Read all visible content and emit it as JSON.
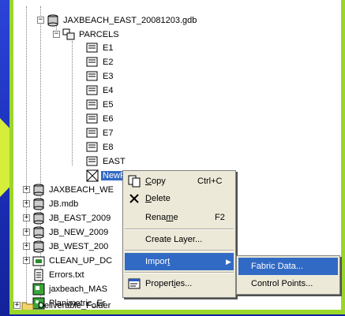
{
  "tree": {
    "gdb_east": "JAXBEACH_EAST_20081203.gdb",
    "parcels": "PARCELS",
    "children": [
      "E1",
      "E2",
      "E3",
      "E4",
      "E5",
      "E6",
      "E7",
      "E8",
      "EAST"
    ],
    "new_fabric": "NewFabric",
    "siblings": [
      "JAXBEACH_WE",
      "JB.mdb",
      "JB_EAST_2009",
      "JB_NEW_2009",
      "JB_WEST_200",
      "CLEAN_UP_DC",
      "Errors.txt",
      "jaxbeach_MAS",
      "Planimetric_Er"
    ],
    "deliverable": "Deliverable_Folder"
  },
  "context_menu": {
    "copy": {
      "pre": "",
      "ul": "C",
      "post": "opy",
      "shortcut": "Ctrl+C"
    },
    "delete": {
      "pre": "",
      "ul": "D",
      "post": "elete"
    },
    "rename": {
      "pre": "Rena",
      "ul": "m",
      "post": "e",
      "shortcut": "F2"
    },
    "create_layer": "Create Layer...",
    "import": {
      "pre": "Impor",
      "ul": "t",
      "post": ""
    },
    "properties": {
      "pre": "Propert",
      "ul": "i",
      "post": "es..."
    }
  },
  "submenu": {
    "fabric_data": "Fabric Data...",
    "control_points": "Control Points..."
  },
  "colors": {
    "background": "#1a2fb8",
    "frame": "#9bd62b",
    "selection": "#316ac5",
    "menu_bg": "#ece9d8"
  }
}
